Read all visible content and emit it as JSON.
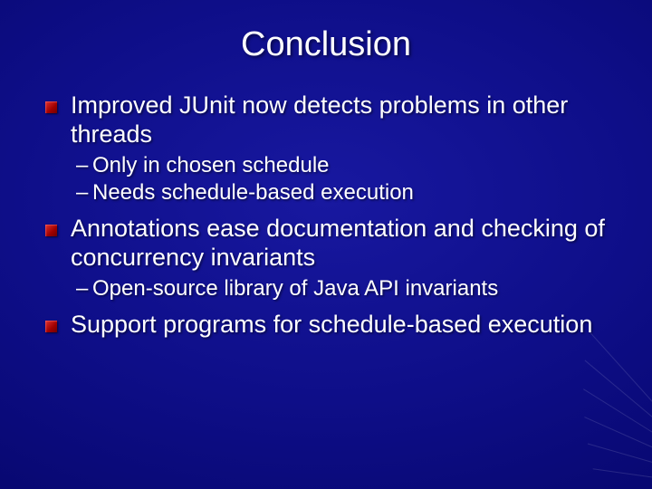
{
  "title": "Conclusion",
  "items": [
    {
      "text": "Improved JUnit now detects problems in other threads",
      "sub": [
        "Only in chosen schedule",
        "Needs schedule-based execution"
      ]
    },
    {
      "text": "Annotations ease documentation and checking of concurrency invariants",
      "sub": [
        "Open-source library of Java API invariants"
      ]
    },
    {
      "text": "Support programs for schedule-based execution",
      "sub": []
    }
  ]
}
